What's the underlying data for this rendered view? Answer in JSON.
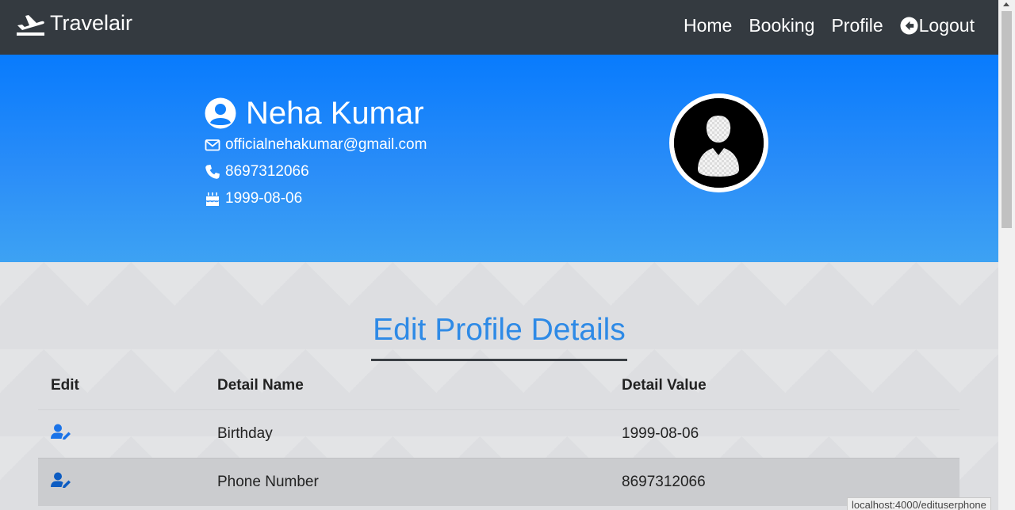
{
  "navbar": {
    "brand": "Travelair",
    "brand_icon": "plane-departure-icon",
    "links": {
      "home": "Home",
      "booking": "Booking",
      "profile": "Profile",
      "logout": "Logout"
    },
    "logout_icon": "arrow-circle-left-icon",
    "background": "#343a40"
  },
  "profile": {
    "name": "Neha Kumar",
    "email": "officialnehakumar@gmail.com",
    "phone": "8697312066",
    "birthday": "1999-08-06",
    "icons": {
      "name": "user-circle-icon",
      "email": "envelope-icon",
      "phone": "phone-icon",
      "birthday": "birthday-cake-icon"
    },
    "hero_color": "#087bfd"
  },
  "edit_section": {
    "title": "Edit Profile Details",
    "title_color": "#2e8ae6",
    "columns": {
      "edit": "Edit",
      "detail_name": "Detail Name",
      "detail_value": "Detail Value"
    },
    "rows": [
      {
        "name": "Birthday",
        "value": "1999-08-06",
        "icon": "user-edit-icon"
      },
      {
        "name": "Phone Number",
        "value": "8697312066",
        "icon": "user-edit-icon"
      }
    ]
  },
  "status_bar": {
    "url": "localhost:4000/edituserphone"
  }
}
